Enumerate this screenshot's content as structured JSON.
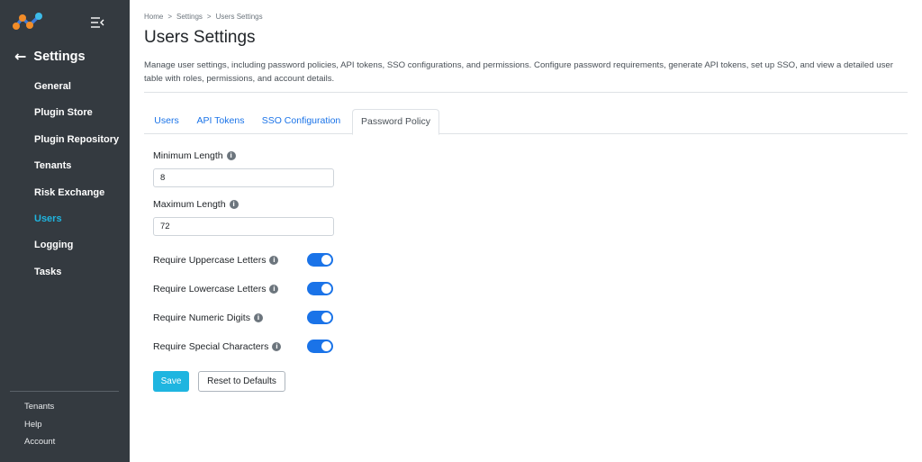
{
  "colors": {
    "sidebar_bg": "#343a40",
    "accent": "#1fb5e0",
    "link_blue": "#1a73e8"
  },
  "sidebar": {
    "back_label": "Settings",
    "items": [
      {
        "label": "General"
      },
      {
        "label": "Plugin Store"
      },
      {
        "label": "Plugin Repository"
      },
      {
        "label": "Tenants"
      },
      {
        "label": "Risk Exchange"
      },
      {
        "label": "Users",
        "active": true
      },
      {
        "label": "Logging"
      },
      {
        "label": "Tasks"
      }
    ],
    "bottom_links": [
      {
        "label": "Tenants"
      },
      {
        "label": "Help"
      },
      {
        "label": "Account"
      }
    ]
  },
  "breadcrumb": [
    "Home",
    "Settings",
    "Users Settings"
  ],
  "page": {
    "title": "Users Settings",
    "description": "Manage user settings, including password policies, API tokens, SSO configurations, and permissions. Configure password requirements, generate API tokens, set up SSO, and view a detailed user table with roles, permissions, and account details."
  },
  "tabs": [
    {
      "label": "Users"
    },
    {
      "label": "API Tokens"
    },
    {
      "label": "SSO Configuration"
    },
    {
      "label": "Password Policy",
      "active": true
    }
  ],
  "form": {
    "min_length": {
      "label": "Minimum Length",
      "value": "8"
    },
    "max_length": {
      "label": "Maximum Length",
      "value": "72"
    },
    "toggles": [
      {
        "label": "Require Uppercase Letters",
        "on": true
      },
      {
        "label": "Require Lowercase Letters",
        "on": true
      },
      {
        "label": "Require Numeric Digits",
        "on": true
      },
      {
        "label": "Require Special Characters",
        "on": true
      }
    ],
    "save_label": "Save",
    "reset_label": "Reset to Defaults"
  }
}
